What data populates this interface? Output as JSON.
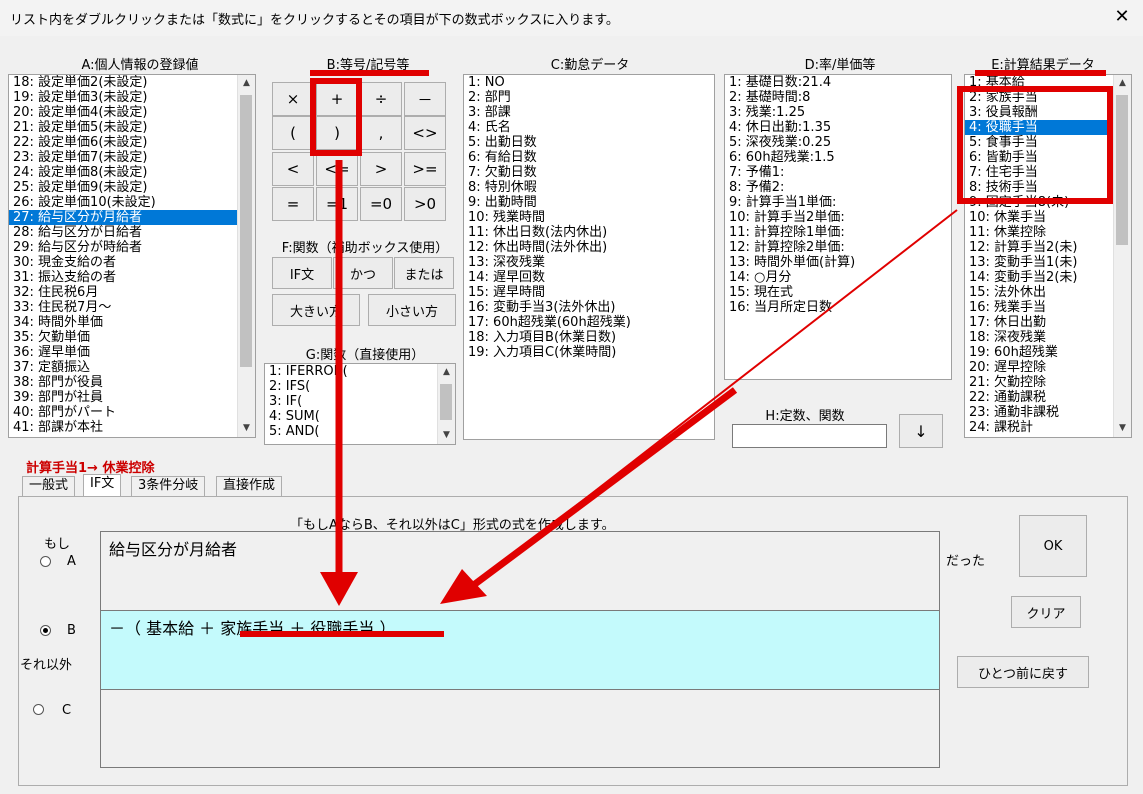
{
  "window": {
    "title": "リスト内をダブルクリックまたは「数式に」をクリックするとその項目が下の数式ボックスに入ります。",
    "close_label": "✕"
  },
  "section_a": {
    "label": "A:個人情報の登録値",
    "items": [
      "18: 設定単価2(未設定)",
      "19: 設定単価3(未設定)",
      "20: 設定単価4(未設定)",
      "21: 設定単価5(未設定)",
      "22: 設定単価6(未設定)",
      "23: 設定単価7(未設定)",
      "24: 設定単価8(未設定)",
      "25: 設定単価9(未設定)",
      "26: 設定単価10(未設定)",
      "27: 給与区分が月給者",
      "28: 給与区分が日給者",
      "29: 給与区分が時給者",
      "30: 現金支給の者",
      "31: 振込支給の者",
      "32: 住民税6月",
      "33: 住民税7月～",
      "34: 時間外単価",
      "35: 欠勤単価",
      "36: 遅早単価",
      "37: 定額振込",
      "38: 部門が役員",
      "39: 部門が社員",
      "40: 部門がパート",
      "41: 部課が本社"
    ],
    "selected_index": 9
  },
  "section_b": {
    "label": "B:等号/記号等",
    "buttons": [
      "×",
      "+",
      "÷",
      "－",
      "(",
      ")",
      ",",
      "<>",
      "<",
      "<=",
      ">",
      ">=",
      "=",
      "=1",
      "=0",
      ">0"
    ]
  },
  "section_f": {
    "label": "F:関数（補助ボックス使用）",
    "if_label": "IF文",
    "and_label": "かつ",
    "or_label": "または",
    "max_label": "大きい方",
    "min_label": "小さい方"
  },
  "section_g": {
    "label": "G:関数（直接使用）",
    "items": [
      "1: IFERROR(",
      "2: IFS(",
      "3: IF(",
      "4: SUM(",
      "5: AND("
    ]
  },
  "section_c": {
    "label": "C:勤怠データ",
    "items": [
      "1: NO",
      "2: 部門",
      "3: 部課",
      "4: 氏名",
      "5: 出勤日数",
      "6: 有給日数",
      "7: 欠勤日数",
      "8: 特別休暇",
      "9: 出勤時間",
      "10: 残業時間",
      "11: 休出日数(法内休出)",
      "12: 休出時間(法外休出)",
      "13: 深夜残業",
      "14: 遅早回数",
      "15: 遅早時間",
      "16: 変動手当3(法外休出)",
      "17: 60h超残業(60h超残業)",
      "18: 入力項目B(休業日数)",
      "19: 入力項目C(休業時間)"
    ]
  },
  "section_d": {
    "label": "D:率/単価等",
    "items": [
      "1: 基礎日数:21.4",
      "2: 基礎時間:8",
      "3: 残業:1.25",
      "4: 休日出勤:1.35",
      "5: 深夜残業:0.25",
      "6: 60h超残業:1.5",
      "7: 予備1:",
      "8: 予備2:",
      "9: 計算手当1単価:",
      "10: 計算手当2単価:",
      "11: 計算控除1単価:",
      "12: 計算控除2単価:",
      "13: 時間外単価(計算)",
      "14: ○月分",
      "15: 現在式",
      "16: 当月所定日数"
    ]
  },
  "section_h": {
    "label": "H:定数、関数",
    "value": "",
    "arrow_label": "↓"
  },
  "section_e": {
    "label": "E:計算結果データ",
    "items": [
      "1: 基本給",
      "2: 家族手当",
      "3: 役員報酬",
      "4: 役職手当",
      "5: 食事手当",
      "6: 皆勤手当",
      "7: 住宅手当",
      "8: 技術手当",
      "9: 固定手当8(未)",
      "10: 休業手当",
      "11: 休業控除",
      "12: 計算手当2(未)",
      "13: 変動手当1(未)",
      "14: 変動手当2(未)",
      "15: 法外休出",
      "16: 残業手当",
      "17: 休日出勤",
      "18: 深夜残業",
      "19: 60h超残業",
      "20: 遅早控除",
      "21: 欠勤控除",
      "22: 通勤課税",
      "23: 通勤非課税",
      "24: 課税計"
    ],
    "selected_index": 3
  },
  "formula_title": "計算手当1→ 休業控除",
  "tabs": [
    "一般式",
    "IF文",
    "3条件分岐",
    "直接作成"
  ],
  "active_tab": 1,
  "panel": {
    "description": "「もしAならB、それ以外はC」形式の式を作成します。",
    "if_label": "もし",
    "radio_a": "A",
    "radio_b": "B",
    "radio_c": "C",
    "else_label": "それ以外",
    "then_label": "だった",
    "formula_a": "給与区分が月給者",
    "formula_b": "－（ 基本給 ＋ 家族手当 ＋ 役職手当 ）",
    "formula_c": "",
    "ok_label": "OK",
    "clear_label": "クリア",
    "undo_label": "ひとつ前に戻す"
  },
  "colors": {
    "annotation_red": "#e00000",
    "selection_blue": "#0078d7",
    "formula_b_bg": "#c4fafc",
    "title_red": "#cc0000"
  }
}
